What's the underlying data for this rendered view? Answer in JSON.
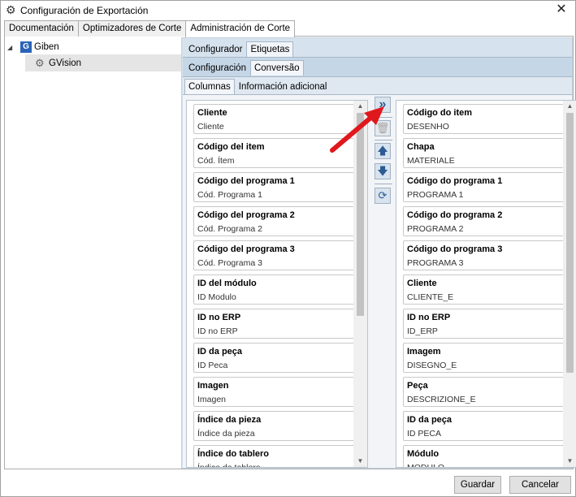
{
  "window": {
    "title": "Configuración de Exportación",
    "icon": "gear-icon",
    "close_label": "✕"
  },
  "tabs_top": [
    {
      "label": "Documentación"
    },
    {
      "label": "Optimizadores de Corte"
    },
    {
      "label": "Administración de Corte"
    }
  ],
  "tree": {
    "root": "Giben",
    "root_logo_letter": "G",
    "child": "GVision"
  },
  "subtabs_1": [
    {
      "label": "Configurador"
    },
    {
      "label": "Etiquetas"
    }
  ],
  "subtabs_2": [
    {
      "label": "Configuración"
    },
    {
      "label": "Conversão"
    }
  ],
  "subtabs_3": [
    {
      "label": "Columnas"
    },
    {
      "label": "Información adicional"
    }
  ],
  "left_list": [
    {
      "name": "Cliente",
      "code": "Cliente"
    },
    {
      "name": "Código del item",
      "code": "Cód. Ítem"
    },
    {
      "name": "Código del programa 1",
      "code": "Cód. Programa 1"
    },
    {
      "name": "Código del programa 2",
      "code": "Cód. Programa 2"
    },
    {
      "name": "Código del programa 3",
      "code": "Cód. Programa 3"
    },
    {
      "name": "ID del módulo",
      "code": "ID Modulo"
    },
    {
      "name": "ID no ERP",
      "code": "ID no ERP"
    },
    {
      "name": "ID da peça",
      "code": "ID Peca"
    },
    {
      "name": "Imagen",
      "code": "Imagen"
    },
    {
      "name": "Índice da pieza",
      "code": "Índice da pieza"
    },
    {
      "name": "Índice do tablero",
      "code": "Índice do tablero"
    }
  ],
  "right_list": [
    {
      "name": "Código do item",
      "code": "DESENHO"
    },
    {
      "name": "Chapa",
      "code": "MATERIALE"
    },
    {
      "name": "Código do programa 1",
      "code": "PROGRAMA 1"
    },
    {
      "name": "Código do programa 2",
      "code": "PROGRAMA 2"
    },
    {
      "name": "Código do programa 3",
      "code": "PROGRAMA 3"
    },
    {
      "name": "Cliente",
      "code": "CLIENTE_E"
    },
    {
      "name": "ID no ERP",
      "code": "ID_ERP"
    },
    {
      "name": "Imagem",
      "code": "DISEGNO_E"
    },
    {
      "name": "Peça",
      "code": "DESCRIZIONE_E"
    },
    {
      "name": "ID da peça",
      "code": "ID PECA"
    },
    {
      "name": "Módulo",
      "code": "MODULO"
    }
  ],
  "toolbar": {
    "move_right_icon": "»",
    "delete_icon": "🗑",
    "move_up_icon": "🡅",
    "move_down_icon": "🡇",
    "refresh_icon": "⟳"
  },
  "scroll": {
    "left_position": 0,
    "right_position": 0
  },
  "annotation_color": "#e0181d",
  "buttons": {
    "save": "Guardar",
    "cancel": "Cancelar"
  }
}
